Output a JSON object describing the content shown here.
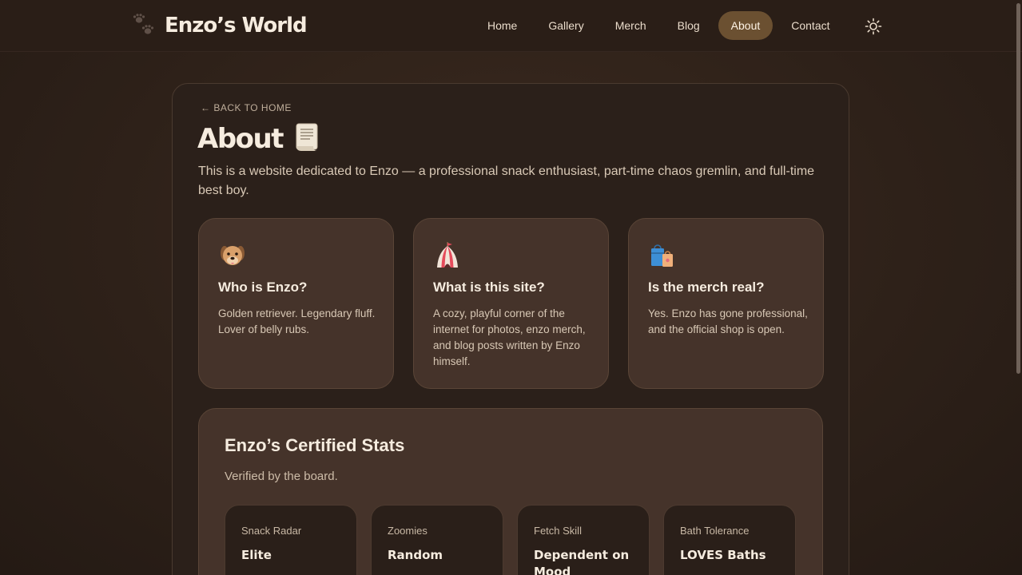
{
  "brand": {
    "title": "Enzo’s World",
    "icon": "paw-prints-icon"
  },
  "nav": {
    "items": [
      {
        "label": "Home"
      },
      {
        "label": "Gallery"
      },
      {
        "label": "Merch"
      },
      {
        "label": "Blog"
      },
      {
        "label": "About",
        "active": true
      },
      {
        "label": "Contact"
      }
    ],
    "theme_toggle_icon": "sun-icon"
  },
  "page": {
    "back_link": "← BACK TO HOME",
    "title": "About",
    "title_icon": "scroll-icon",
    "intro": "This is a website dedicated to Enzo — a professional snack enthusiast, part-time chaos gremlin, and full-time best boy."
  },
  "cards": [
    {
      "icon": "dog-face-icon",
      "title": "Who is Enzo?",
      "body": "Golden retriever. Legendary fluff. Lover of belly rubs."
    },
    {
      "icon": "circus-tent-icon",
      "title": "What is this site?",
      "body": "A cozy, playful corner of the internet for photos, enzo merch, and blog posts written by Enzo himself."
    },
    {
      "icon": "shopping-bags-icon",
      "title": "Is the merch real?",
      "body": "Yes. Enzo has gone professional, and the official shop is open."
    }
  ],
  "stats": {
    "title": "Enzo’s Certified Stats",
    "subtitle": "Verified by the board.",
    "items": [
      {
        "label": "Snack Radar",
        "value": "Elite"
      },
      {
        "label": "Zoomies",
        "value": "Random"
      },
      {
        "label": "Fetch Skill",
        "value": "Dependent on Mood"
      },
      {
        "label": "Bath Tolerance",
        "value": "LOVES Baths"
      }
    ]
  },
  "colors": {
    "accent": "#6b5031",
    "background": "#2e2119",
    "card": "#45332a",
    "text": "#f6ecdf"
  }
}
